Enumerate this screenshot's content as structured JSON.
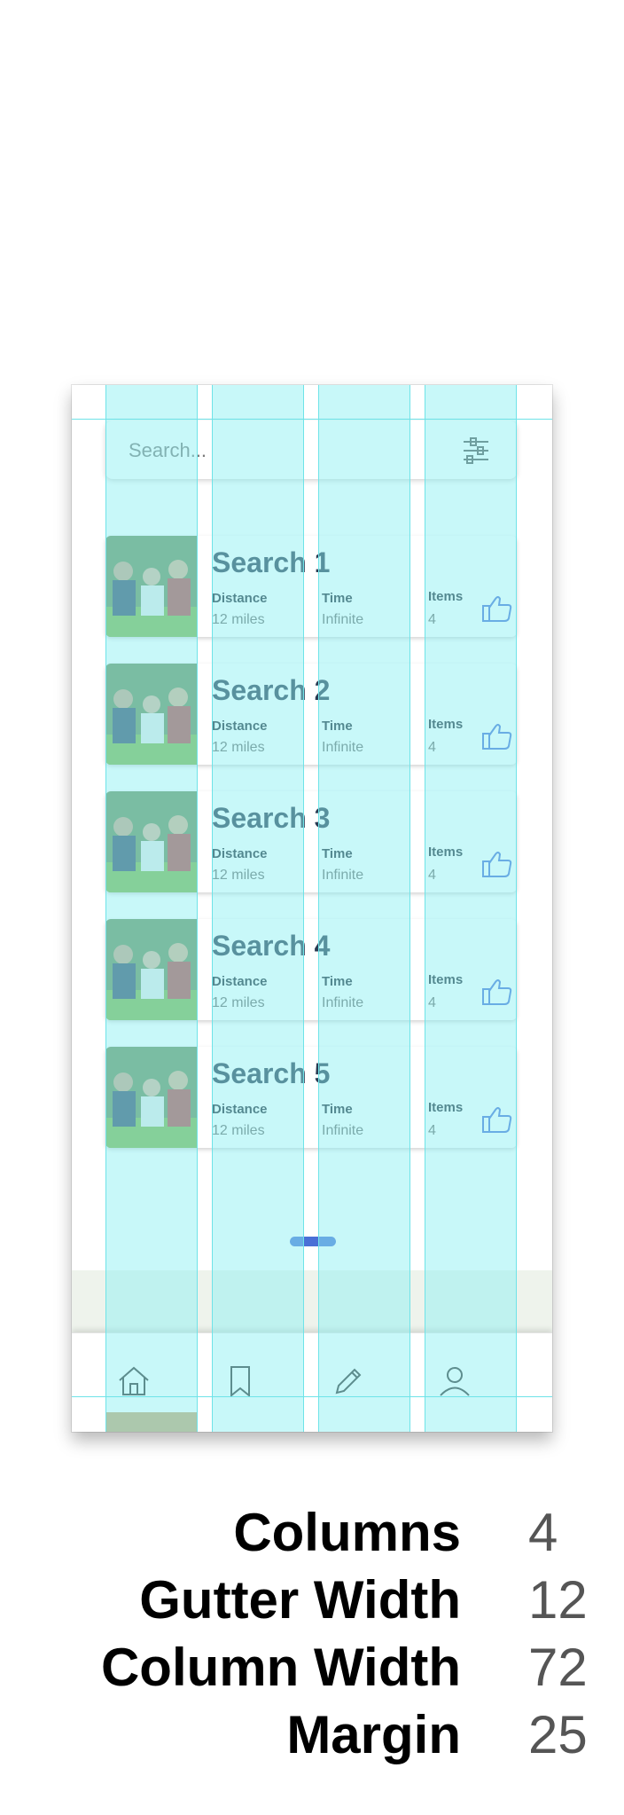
{
  "search": {
    "placeholder": "Search..."
  },
  "results": [
    {
      "title": "Search 1",
      "distance_label": "Distance",
      "distance_value": "12 miles",
      "time_label": "Time",
      "time_value": "Infinite",
      "items_label": "Items",
      "items_value": "4"
    },
    {
      "title": "Search 2",
      "distance_label": "Distance",
      "distance_value": "12 miles",
      "time_label": "Time",
      "time_value": "Infinite",
      "items_label": "Items",
      "items_value": "4"
    },
    {
      "title": "Search 3",
      "distance_label": "Distance",
      "distance_value": "12 miles",
      "time_label": "Time",
      "time_value": "Infinite",
      "items_label": "Items",
      "items_value": "4"
    },
    {
      "title": "Search 4",
      "distance_label": "Distance",
      "distance_value": "12 miles",
      "time_label": "Time",
      "time_value": "Infinite",
      "items_label": "Items",
      "items_value": "4"
    },
    {
      "title": "Search 5",
      "distance_label": "Distance",
      "distance_value": "12 miles",
      "time_label": "Time",
      "time_value": "Infinite",
      "items_label": "Items",
      "items_value": "4"
    }
  ],
  "nav": {
    "items": [
      {
        "icon": "home-icon"
      },
      {
        "icon": "bookmark-icon"
      },
      {
        "icon": "pencil-icon"
      },
      {
        "icon": "profile-icon"
      }
    ]
  },
  "grid_specs": {
    "columns_label": "Columns",
    "columns_value": "4",
    "gutter_label": "Gutter Width",
    "gutter_value": "12",
    "column_width_label": "Column Width",
    "column_width_value": "72",
    "margin_label": "Margin",
    "margin_value": "25"
  },
  "colors": {
    "grid_overlay": "#8cf0f2",
    "title": "#2a3b52",
    "icon_blue": "#4a6fd6"
  }
}
